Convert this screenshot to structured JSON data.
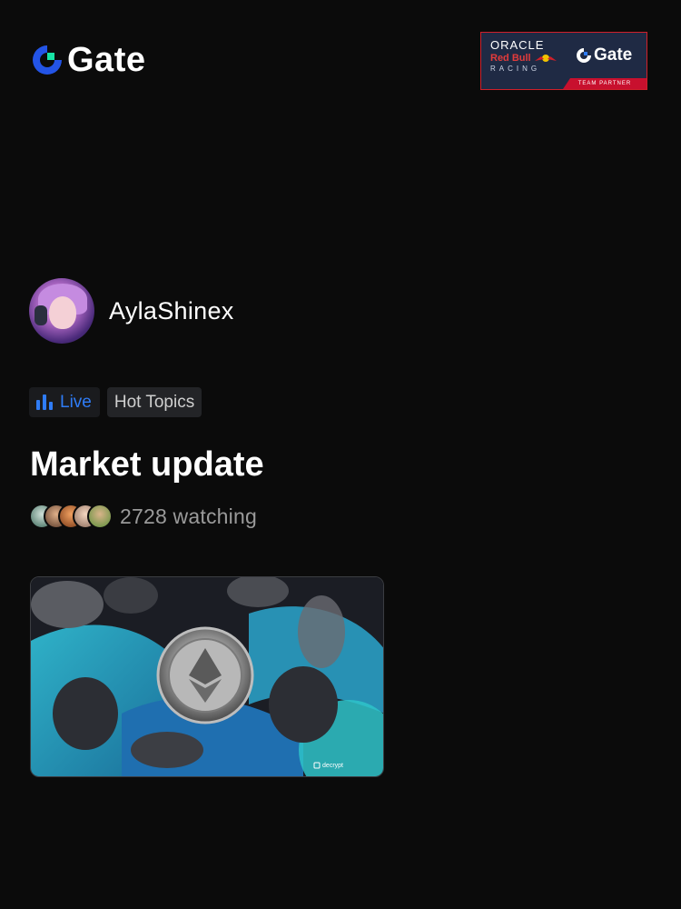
{
  "brand": {
    "name": "Gate",
    "accent": "#2354e6",
    "accent_green": "#17e5a5"
  },
  "partner_badge": {
    "oracle": "ORACLE",
    "redbull": "Red Bull",
    "racing": "RACING",
    "gate": "Gate",
    "team_partner": "TEAM PARTNER"
  },
  "streamer": {
    "name": "AylaShinex",
    "avatar_icon": "avatar-portrait"
  },
  "tags": {
    "live_label": "Live",
    "topic_label": "Hot Topics",
    "live_color": "#2f7cf6"
  },
  "stream": {
    "title": "Market update",
    "watching": "2728 watching"
  },
  "cover": {
    "watermark": "decrypt",
    "icon": "ethereum-coin-illustration"
  }
}
